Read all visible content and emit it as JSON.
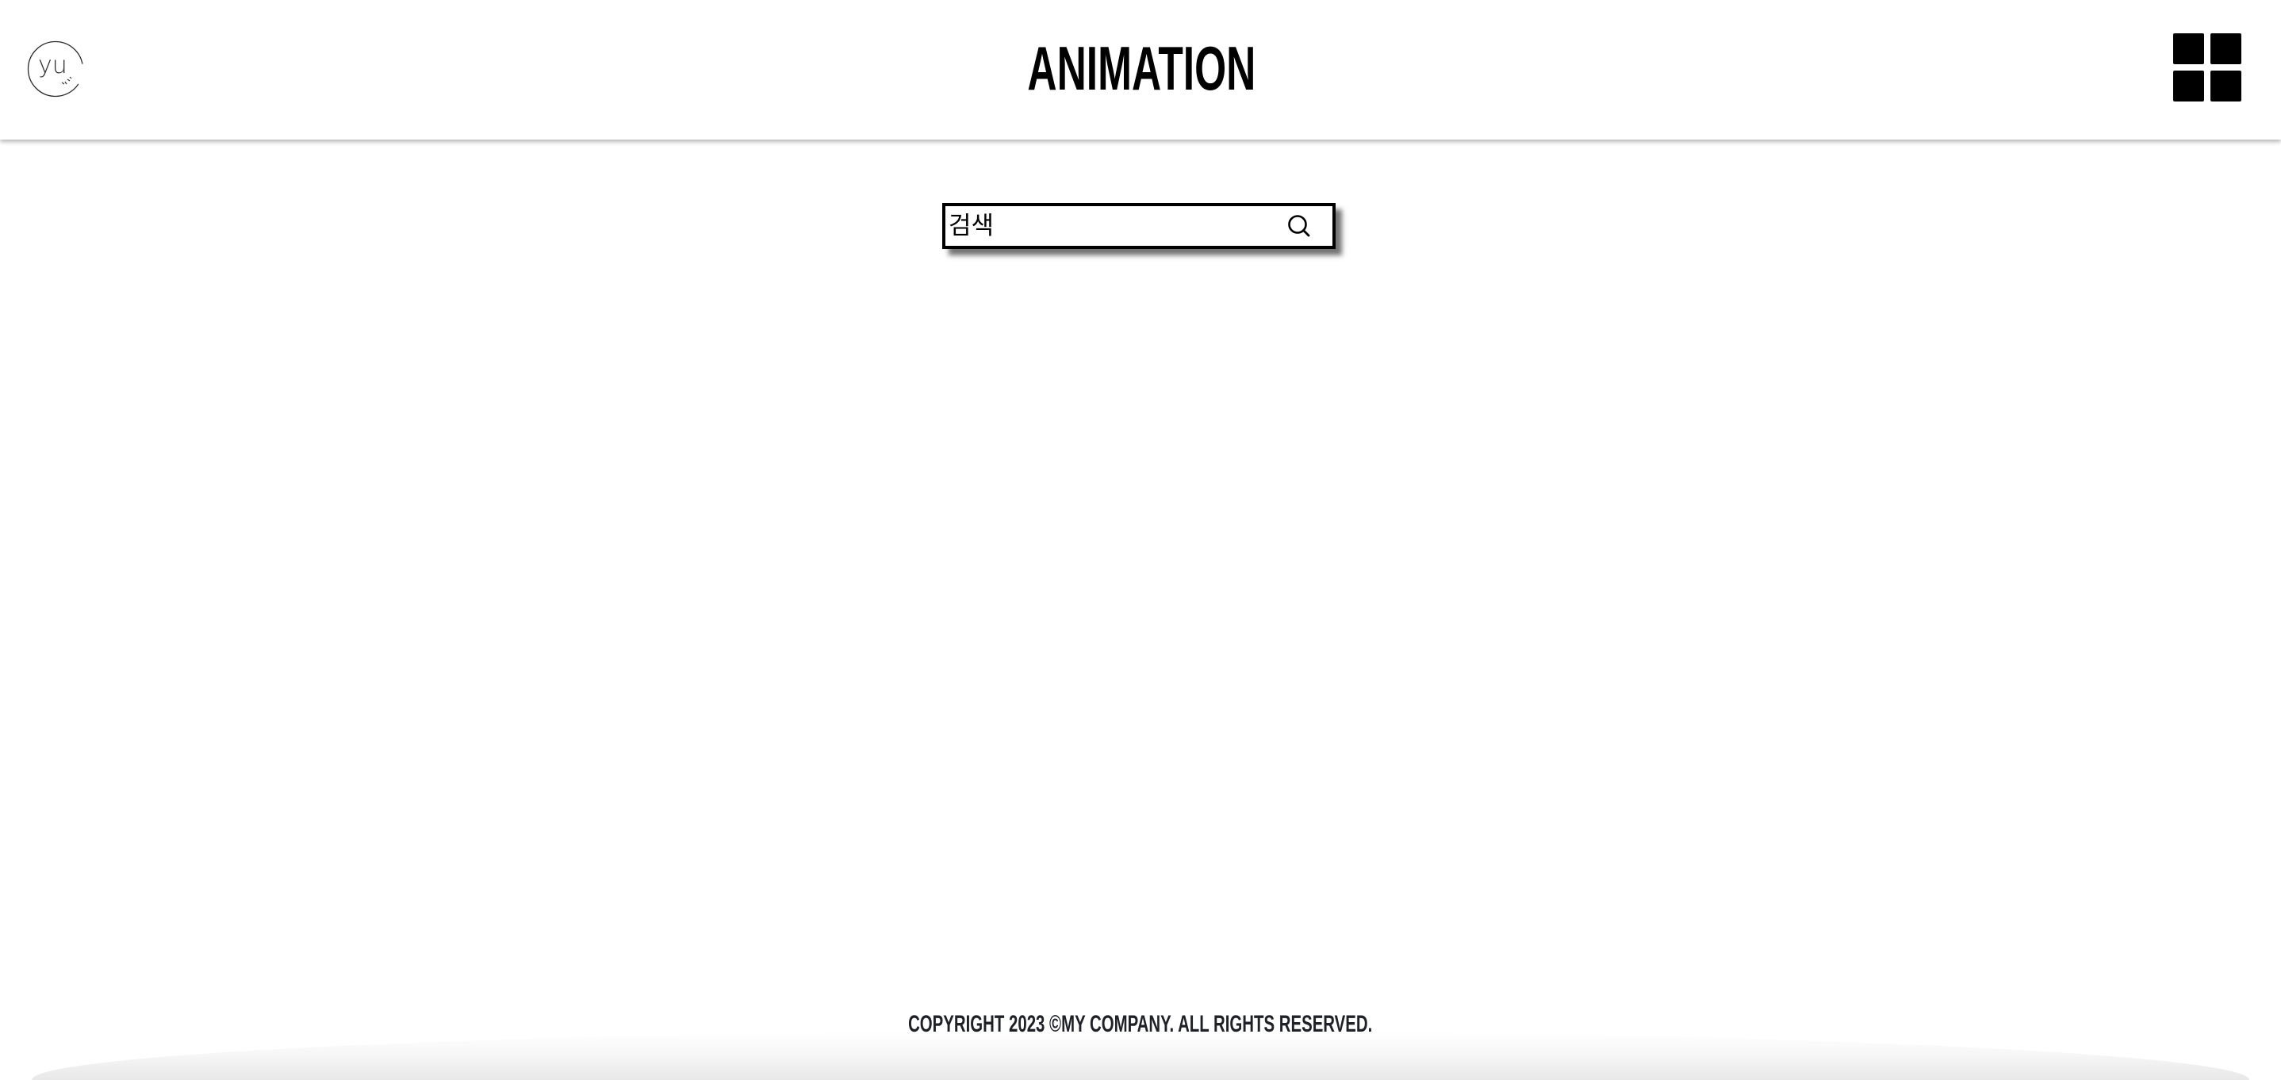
{
  "header": {
    "logo_text": "yu",
    "title": "ANIMATION",
    "menu_icon": "grid-icon"
  },
  "search": {
    "placeholder": "검색",
    "icon": "search-icon"
  },
  "footer": {
    "copyright": "COPYRIGHT 2023 ©MY COMPANY. ALL RIGHTS RESERVED."
  },
  "colors": {
    "background": "#ffffff",
    "text": "#000000",
    "footer_text": "#1f2128"
  }
}
